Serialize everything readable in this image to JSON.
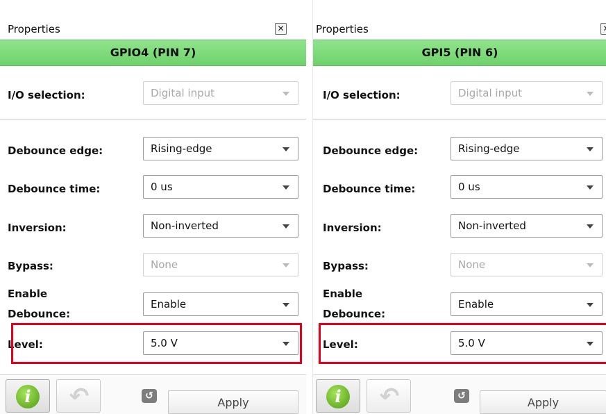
{
  "panels": [
    {
      "title": "Properties",
      "close_glyph": "✕",
      "header": "GPIO4 (PIN 7)",
      "io_selection": {
        "label": "I/O selection:",
        "value": "Digital input"
      },
      "debounce_edge": {
        "label": "Debounce edge:",
        "value": "Rising-edge"
      },
      "debounce_time": {
        "label": "Debounce time:",
        "value": "0 us"
      },
      "inversion": {
        "label": "Inversion:",
        "value": "Non-inverted"
      },
      "bypass": {
        "label": "Bypass:",
        "value": "None"
      },
      "enable_debounce": {
        "label_line1": "Enable",
        "label_line2": "Debounce:",
        "value": "Enable"
      },
      "level": {
        "label": "Level:",
        "value": "5.0 V"
      },
      "footer": {
        "info_glyph": "i",
        "undo_glyph": "↶",
        "reset_glyph": "↺",
        "apply_label": "Apply"
      }
    },
    {
      "title": "Properties",
      "close_glyph": "✕",
      "header": "GPI5 (PIN 6)",
      "io_selection": {
        "label": "I/O selection:",
        "value": "Digital input"
      },
      "debounce_edge": {
        "label": "Debounce edge:",
        "value": "Rising-edge"
      },
      "debounce_time": {
        "label": "Debounce time:",
        "value": "0 us"
      },
      "inversion": {
        "label": "Inversion:",
        "value": "Non-inverted"
      },
      "bypass": {
        "label": "Bypass:",
        "value": "None"
      },
      "enable_debounce": {
        "label_line1": "Enable",
        "label_line2": "Debounce:",
        "value": "Enable"
      },
      "level": {
        "label": "Level:",
        "value": "5.0 V"
      },
      "footer": {
        "info_glyph": "i",
        "undo_glyph": "↶",
        "reset_glyph": "↺",
        "apply_label": "Apply"
      }
    }
  ],
  "colors": {
    "header_green": "#6fd26b",
    "highlight_red": "#e3001b",
    "disabled_text": "#a8a8a8",
    "info_green": "#4e9b14"
  },
  "icons": [
    "close-icon",
    "chevron-down-icon",
    "info-icon",
    "undo-icon",
    "reset-icon"
  ]
}
